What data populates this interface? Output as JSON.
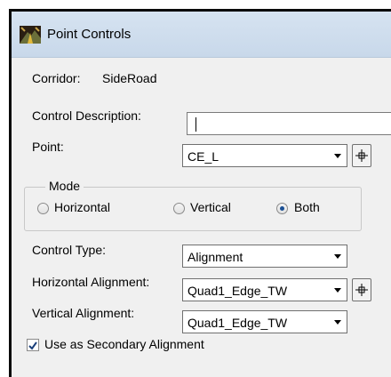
{
  "window": {
    "title": "Point Controls"
  },
  "corridor": {
    "label": "Corridor:",
    "value": "SideRoad"
  },
  "control_description": {
    "label": "Control Description:",
    "value": ""
  },
  "point": {
    "label": "Point:",
    "value": "CE_L"
  },
  "mode": {
    "legend": "Mode",
    "options": [
      "Horizontal",
      "Vertical",
      "Both"
    ],
    "selected": "Both"
  },
  "control_type": {
    "label": "Control Type:",
    "value": "Alignment"
  },
  "horizontal_alignment": {
    "label": "Horizontal Alignment:",
    "value": "Quad1_Edge_TW"
  },
  "vertical_alignment": {
    "label": "Vertical Alignment:",
    "value": "Quad1_Edge_TW"
  },
  "secondary_alignment": {
    "label": "Use as Secondary Alignment",
    "checked": true
  },
  "colors": {
    "title_bar": "#d1dfef",
    "dialog_bg": "#f0f0f0",
    "radio_dot": "#1a4f94"
  }
}
